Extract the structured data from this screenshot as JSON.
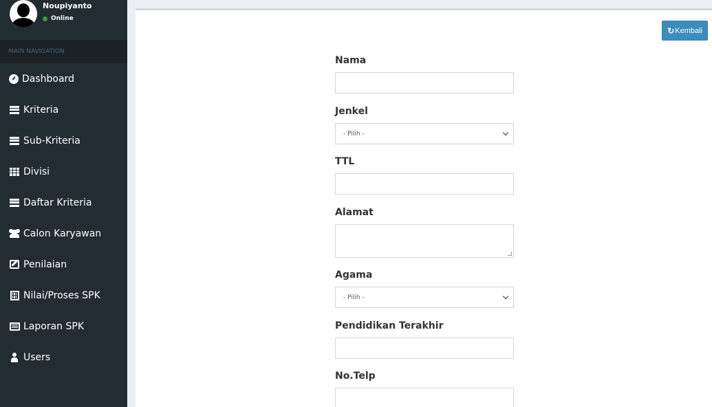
{
  "user": {
    "name": "Noupiyanto",
    "status": "Online"
  },
  "sidebar": {
    "header": "MAIN NAVIGATION",
    "items": [
      {
        "label": "Dashboard",
        "icon": "dashboard-icon"
      },
      {
        "label": "Kriteria",
        "icon": "list-icon"
      },
      {
        "label": "Sub-Kriteria",
        "icon": "list-ul-icon"
      },
      {
        "label": "Divisi",
        "icon": "grid-icon"
      },
      {
        "label": "Daftar Kriteria",
        "icon": "list-alt-icon"
      },
      {
        "label": "Calon Karyawan",
        "icon": "users-icon"
      },
      {
        "label": "Penilaian",
        "icon": "edit-icon"
      },
      {
        "label": "Nilai/Proses SPK",
        "icon": "calculator-icon"
      },
      {
        "label": "Laporan SPK",
        "icon": "report-icon"
      },
      {
        "label": "Users",
        "icon": "user-icon"
      }
    ]
  },
  "toolbar": {
    "back_label": "Kembali",
    "back_icon": "refresh-icon"
  },
  "form": {
    "nama": {
      "label": "Nama",
      "value": ""
    },
    "jenkel": {
      "label": "Jenkel",
      "selected": "- Pilih -"
    },
    "ttl": {
      "label": "TTL",
      "value": ""
    },
    "alamat": {
      "label": "Alamat",
      "value": ""
    },
    "agama": {
      "label": "Agama",
      "selected": "- Pilih -"
    },
    "pendidikan": {
      "label": "Pendidikan Terakhir",
      "value": ""
    },
    "notelp": {
      "label": "No.Telp",
      "value": ""
    }
  },
  "colors": {
    "sidebar": "#222d32",
    "accent": "#3c8dbc",
    "online": "#3c9b4b"
  }
}
